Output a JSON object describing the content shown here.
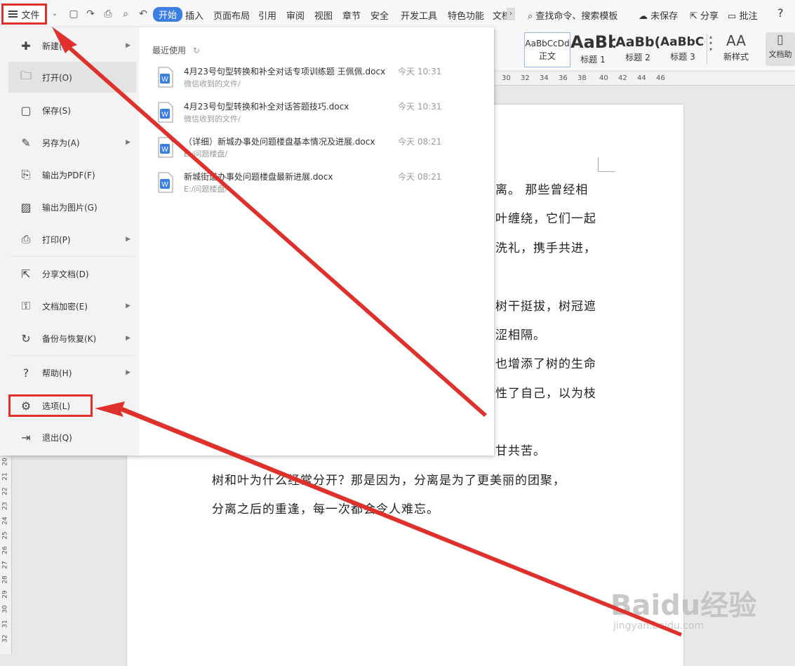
{
  "toolbar": {
    "file_label": "文件",
    "tabs": [
      "开始",
      "插入",
      "页面布局",
      "引用",
      "审阅",
      "视图",
      "章节",
      "安全",
      "开发工具",
      "特色功能",
      "文档"
    ],
    "search_placeholder": "查找命令、搜索模板",
    "unsaved": "未保存",
    "share": "分享",
    "comment": "批注",
    "help": "?"
  },
  "styles": [
    {
      "sample": "AaBbCcDd",
      "label": "正文"
    },
    {
      "sample": "AaBb",
      "label": "标题 1"
    },
    {
      "sample": "AaBb(",
      "label": "标题 2"
    },
    {
      "sample": "AaBbC(",
      "label": "标题 3"
    },
    {
      "sample": "AA",
      "label": "新样式"
    },
    {
      "label": "文档助"
    }
  ],
  "ruler": [
    "30",
    "32",
    "34",
    "36",
    "38",
    "40",
    "42",
    "44",
    "46"
  ],
  "vruler": [
    "20",
    "21",
    "22",
    "23",
    "24",
    "25",
    "26",
    "27",
    "28",
    "29",
    "30",
    "31",
    "32"
  ],
  "menu": {
    "items": [
      {
        "label": "新建(N)",
        "icon": "new-file-icon",
        "arrow": true
      },
      {
        "label": "打开(O)",
        "icon": "folder-icon",
        "arrow": false
      },
      {
        "label": "保存(S)",
        "icon": "save-icon",
        "arrow": false
      },
      {
        "label": "另存为(A)",
        "icon": "save-as-icon",
        "arrow": true
      },
      {
        "label": "输出为PDF(F)",
        "icon": "pdf-icon",
        "arrow": false
      },
      {
        "label": "输出为图片(G)",
        "icon": "image-icon",
        "arrow": false
      },
      {
        "label": "打印(P)",
        "icon": "printer-icon",
        "arrow": true
      },
      {
        "label": "分享文档(D)",
        "icon": "share-icon",
        "arrow": false
      },
      {
        "label": "文档加密(E)",
        "icon": "encrypt-icon",
        "arrow": true
      },
      {
        "label": "备份与恢复(K)",
        "icon": "backup-icon",
        "arrow": true
      },
      {
        "label": "帮助(H)",
        "icon": "help-icon",
        "arrow": true
      },
      {
        "label": "选项(L)",
        "icon": "gear-icon",
        "arrow": false
      },
      {
        "label": "退出(Q)",
        "icon": "exit-icon",
        "arrow": false
      }
    ],
    "recent_title": "最近使用",
    "recent_files": [
      {
        "name": "4月23号句型转换和补全对话专项训练题 王佩佩.docx",
        "path": "微信收到的文件/",
        "time": "今天 10:31"
      },
      {
        "name": "4月23号句型转换和补全对话答题技巧.docx",
        "path": "微信收到的文件/",
        "time": "今天 10:31"
      },
      {
        "name": "（详细）新城办事处问题楼盘基本情况及进展.docx",
        "path": "E:/问题楼盘/",
        "time": "今天 08:21"
      },
      {
        "name": "新城街道办事处问题楼盘最新进展.docx",
        "path": "E:/问题楼盘/",
        "time": "今天 08:21"
      }
    ]
  },
  "document": {
    "lines": [
      "离。  那些曾经相",
      "叶缠绕，它们一起",
      "洗礼，携手共进，",
      "树干挺拔，树冠遮",
      "涩相隔。",
      "也增添了树的生命",
      "性了自己，以为枝",
      "甘共苦。",
      "树和叶为什么经常分开？那是因为，分离是为了更美丽的团聚，",
      "分离之后的重逢，每一次都会令人难忘。"
    ]
  },
  "watermark": {
    "main": "Baidu经验",
    "sub": "jingyan.baidu.com"
  },
  "colors": {
    "accent": "#3b7fe2",
    "annotation": "#e0302b"
  }
}
